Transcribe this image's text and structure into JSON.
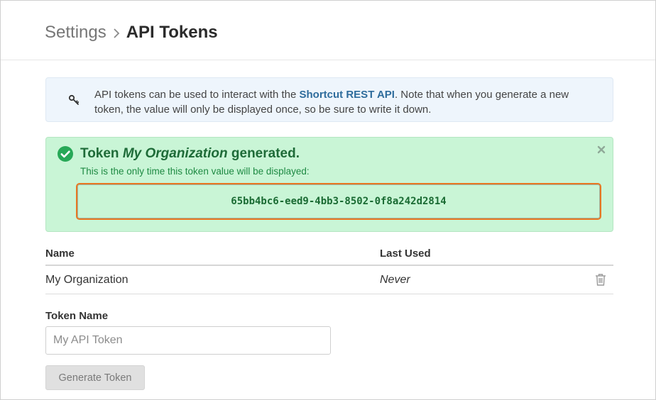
{
  "breadcrumb": {
    "parent": "Settings",
    "current": "API Tokens"
  },
  "info": {
    "icon": "key-icon",
    "text_before": "API tokens can be used to interact with the ",
    "link_text": "Shortcut REST API",
    "text_after": ". Note that when you generate a new token, the value will only be displayed once, so be sure to write it down."
  },
  "success": {
    "icon": "check-circle-icon",
    "title_prefix": "Token ",
    "title_name": "My Organization",
    "title_suffix": " generated.",
    "subtitle": "This is the only time this token value will be displayed:",
    "token_value": "65bb4bc6-eed9-4bb3-8502-0f8a242d2814",
    "highlight_color": "#e87722"
  },
  "table": {
    "headers": {
      "name": "Name",
      "last_used": "Last Used"
    },
    "rows": [
      {
        "name": "My Organization",
        "last_used": "Never"
      }
    ]
  },
  "form": {
    "label": "Token Name",
    "placeholder": "My API Token",
    "value": "",
    "button_label": "Generate Token"
  },
  "colors": {
    "success_bg": "#c9f5d6",
    "success_text": "#1e6b38",
    "info_bg": "#eef5fc",
    "link": "#2e6c9c"
  }
}
